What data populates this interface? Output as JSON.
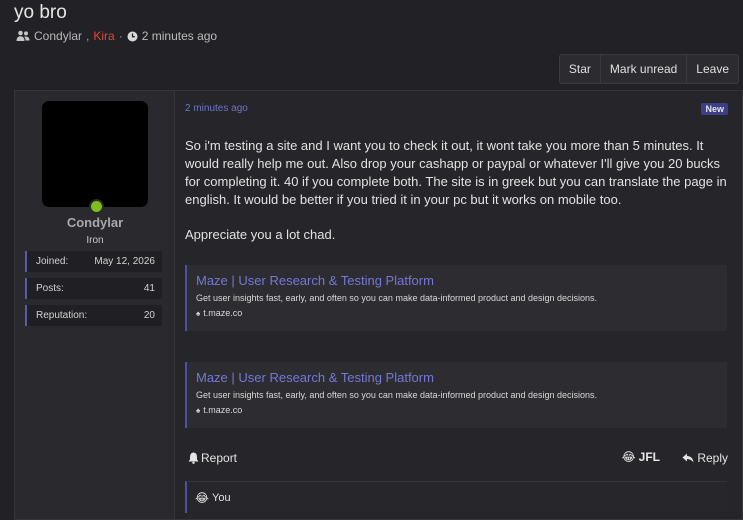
{
  "thread": {
    "title": "yo bro",
    "participants": [
      "Condylar",
      "Kira"
    ],
    "time_ago": "2 minutes ago"
  },
  "actions": [
    "Star",
    "Mark unread",
    "Leave"
  ],
  "author": {
    "name": "Condylar",
    "rank": "Iron",
    "stats": [
      {
        "label": "Joined:",
        "value": "May 12, 2026"
      },
      {
        "label": "Posts:",
        "value": "41"
      },
      {
        "label": "Reputation:",
        "value": "20"
      }
    ]
  },
  "post": {
    "time": "2 minutes ago",
    "badge": "New",
    "paragraphs": [
      "So i'm testing a site and I want you to check it out, it wont take you more than 5 minutes. It would really help me out. Also drop your cashapp or paypal or whatever I'll give you 20 bucks for completing it. 40 if you complete both. The site is in greek but you can translate the page in english. It would be better if you tried it in your pc but it works on mobile too.",
      "Appreciate you a lot chad."
    ],
    "unfurls": [
      {
        "title": "Maze | User Research & Testing Platform",
        "desc": "Get user insights fast, early, and often so you can make data-informed product and design decisions.",
        "host": "t.maze.co"
      },
      {
        "title": "Maze | User Research & Testing Platform",
        "desc": "Get user insights fast, early, and often so you can make data-informed product and design decisions.",
        "host": "t.maze.co"
      }
    ],
    "report_label": "Report",
    "reaction_label": "JFL",
    "reply_label": "Reply",
    "reacted_by": "You"
  }
}
